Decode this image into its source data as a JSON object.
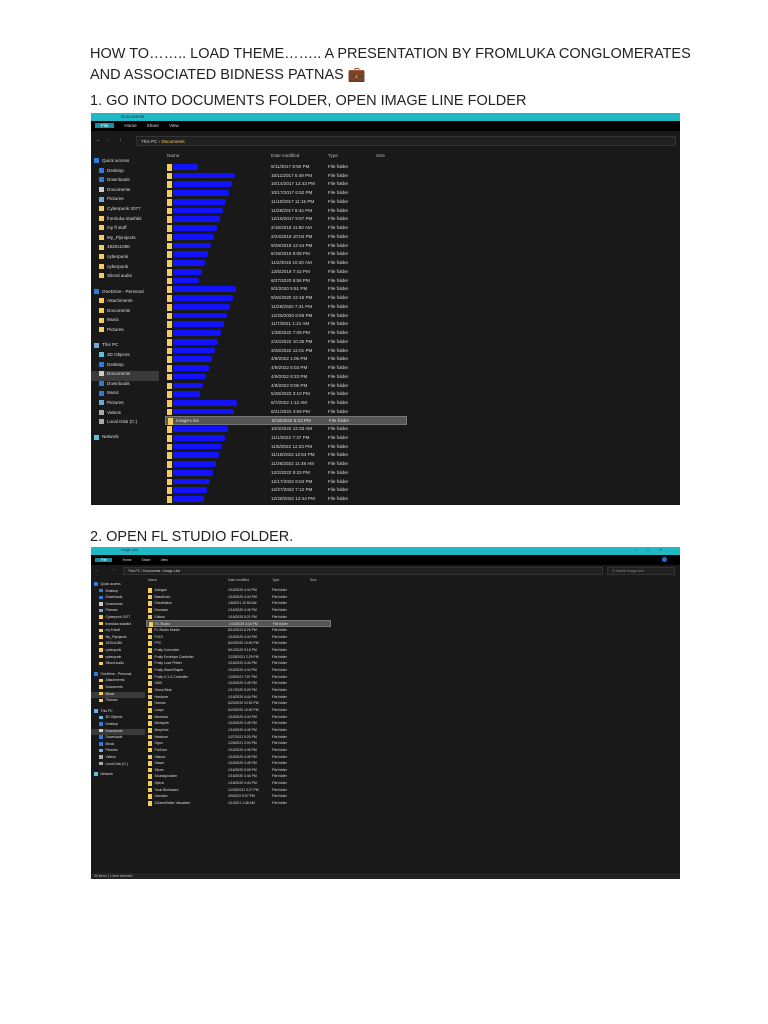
{
  "doc": {
    "heading_line1": "HOW TO…….. LOAD THEME…….. A PRESENTATION BY FROMLUKA CONGLOMERATES",
    "heading_line2": "AND ASSOCIATED BIDNESS PATNAS 💼",
    "step1": "1. GO INTO DOCUMENTS FOLDER, OPEN IMAGE LINE FOLDER",
    "step2": "2. OPEN FL STUDIO FOLDER."
  },
  "shot1": {
    "title": "Documents",
    "ribbon": [
      "File",
      "Home",
      "Share",
      "View"
    ],
    "breadcrumb": [
      "This PC",
      "Documents"
    ],
    "columns": [
      "Name",
      "Date modified",
      "Type",
      "Size"
    ],
    "sidebar": [
      {
        "label": "Quick access",
        "icon": "star-icon"
      },
      {
        "label": "Desktop",
        "icon": "desktop-icon"
      },
      {
        "label": "Downloads",
        "icon": "download-icon"
      },
      {
        "label": "Documents",
        "icon": "document-icon"
      },
      {
        "label": "Pictures",
        "icon": "pictures-icon"
      },
      {
        "label": "Cyberpunk 2077",
        "icon": "folder-icon"
      },
      {
        "label": "fromluka stashkit",
        "icon": "folder-icon"
      },
      {
        "label": "my fl stuff",
        "icon": "folder-icon"
      },
      {
        "label": "My_Flprojects",
        "icon": "folder-icon"
      },
      {
        "label": "1920x1080",
        "icon": "folder-icon"
      },
      {
        "label": "cyberpunk",
        "icon": "folder-icon"
      },
      {
        "label": "cyberpunk",
        "icon": "folder-icon"
      },
      {
        "label": "Sliced audio",
        "icon": "folder-icon"
      },
      {
        "label": "OneDrive - Personal",
        "icon": "cloud-icon"
      },
      {
        "label": "Attachments",
        "icon": "folder-icon"
      },
      {
        "label": "Documents",
        "icon": "folder-icon"
      },
      {
        "label": "Music",
        "icon": "folder-icon"
      },
      {
        "label": "Pictures",
        "icon": "folder-icon"
      },
      {
        "label": "This PC",
        "icon": "computer-icon"
      },
      {
        "label": "3D Objects",
        "icon": "cube-icon"
      },
      {
        "label": "Desktop",
        "icon": "desktop-icon"
      },
      {
        "label": "Documents",
        "icon": "document-icon",
        "selected": true
      },
      {
        "label": "Downloads",
        "icon": "download-icon"
      },
      {
        "label": "Music",
        "icon": "music-icon"
      },
      {
        "label": "Pictures",
        "icon": "pictures-icon"
      },
      {
        "label": "Videos",
        "icon": "video-icon"
      },
      {
        "label": "Local Disk (C:)",
        "icon": "disk-icon"
      },
      {
        "label": "Network",
        "icon": "network-icon"
      }
    ],
    "rows": [
      {
        "name": "",
        "date": "9/11/2017 8:50 PM",
        "type": "File folder"
      },
      {
        "name": "",
        "date": "10/11/2017 5:49 PM",
        "type": "File folder"
      },
      {
        "name": "",
        "date": "10/14/2017 12:43 PM",
        "type": "File folder"
      },
      {
        "name": "",
        "date": "10/17/2017 6:52 PM",
        "type": "File folder"
      },
      {
        "name": "",
        "date": "11/10/2017 11:15 PM",
        "type": "File folder"
      },
      {
        "name": "",
        "date": "11/28/2017 9:44 PM",
        "type": "File folder"
      },
      {
        "name": "",
        "date": "12/16/2017 9:57 PM",
        "type": "File folder"
      },
      {
        "name": "",
        "date": "2/18/2018 11:50 AM",
        "type": "File folder"
      },
      {
        "name": "",
        "date": "2/24/2018 10:04 PM",
        "type": "File folder"
      },
      {
        "name": "",
        "date": "9/29/2018 12:44 PM",
        "type": "File folder"
      },
      {
        "name": "",
        "date": "8/19/2019 8:08 PM",
        "type": "File folder"
      },
      {
        "name": "",
        "date": "11/2/2019 10:20 AM",
        "type": "File folder"
      },
      {
        "name": "",
        "date": "12/5/2019 7:42 PM",
        "type": "File folder"
      },
      {
        "name": "",
        "date": "6/27/2020 6:58 PM",
        "type": "File folder"
      },
      {
        "name": "",
        "date": "9/2/2020 5:51 PM",
        "type": "File folder"
      },
      {
        "name": "",
        "date": "9/26/2020 12:16 PM",
        "type": "File folder"
      },
      {
        "name": "",
        "date": "11/29/2020 7:41 PM",
        "type": "File folder"
      },
      {
        "name": "",
        "date": "12/25/2020 6:59 PM",
        "type": "File folder"
      },
      {
        "name": "",
        "date": "11/7/2021 1:21 AM",
        "type": "File folder"
      },
      {
        "name": "",
        "date": "1/28/2022 7:08 PM",
        "type": "File folder"
      },
      {
        "name": "",
        "date": "2/22/2022 10:35 PM",
        "type": "File folder"
      },
      {
        "name": "",
        "date": "3/26/2022 12:01 PM",
        "type": "File folder"
      },
      {
        "name": "",
        "date": "4/9/2022 1:05 PM",
        "type": "File folder"
      },
      {
        "name": "",
        "date": "4/9/2022 8:03 PM",
        "type": "File folder"
      },
      {
        "name": "",
        "date": "4/9/2022 8:23 PM",
        "type": "File folder"
      },
      {
        "name": "",
        "date": "4/9/2022 9:06 PM",
        "type": "File folder"
      },
      {
        "name": "",
        "date": "5/28/2022 2:10 PM",
        "type": "File folder"
      },
      {
        "name": "",
        "date": "8/7/2022 1:12 AM",
        "type": "File folder"
      },
      {
        "name": "",
        "date": "8/21/2022 4:59 PM",
        "type": "File folder"
      },
      {
        "name": "Image-Line",
        "date": "8/18/2022 6:23 PM",
        "type": "File folder",
        "selected": true
      },
      {
        "name": "",
        "date": "10/3/2022 12:33 AM",
        "type": "File folder"
      },
      {
        "name": "",
        "date": "11/1/2022 7:37 PM",
        "type": "File folder"
      },
      {
        "name": "",
        "date": "11/5/2022 12:23 PM",
        "type": "File folder"
      },
      {
        "name": "",
        "date": "11/18/2022 12:54 PM",
        "type": "File folder"
      },
      {
        "name": "",
        "date": "11/26/2022 11:48 AM",
        "type": "File folder"
      },
      {
        "name": "",
        "date": "12/2/2022 9:33 PM",
        "type": "File folder"
      },
      {
        "name": "",
        "date": "12/17/2022 6:04 PM",
        "type": "File folder"
      },
      {
        "name": "",
        "date": "12/27/2022 7:12 PM",
        "type": "File folder"
      },
      {
        "name": "",
        "date": "12/28/2022 12:44 PM",
        "type": "File folder"
      }
    ]
  },
  "shot2": {
    "title": "Image-Line",
    "ribbon": [
      "File",
      "Home",
      "Share",
      "View"
    ],
    "breadcrumb": [
      "This PC",
      "Documents",
      "Image-Line"
    ],
    "search_placeholder": "Search Image-Line",
    "columns": [
      "Name",
      "Date modified",
      "Type",
      "Size"
    ],
    "status": "33 items  |  1 item selected",
    "sidebar": [
      {
        "label": "Quick access",
        "icon": "star-icon"
      },
      {
        "label": "Desktop",
        "icon": "desktop-icon"
      },
      {
        "label": "Downloads",
        "icon": "download-icon"
      },
      {
        "label": "Documents",
        "icon": "document-icon"
      },
      {
        "label": "Pictures",
        "icon": "pictures-icon"
      },
      {
        "label": "Cyberpunk 2077",
        "icon": "folder-icon"
      },
      {
        "label": "fromluka stashkit",
        "icon": "folder-icon"
      },
      {
        "label": "my fl stuff",
        "icon": "folder-icon"
      },
      {
        "label": "My_Flprojects",
        "icon": "folder-icon"
      },
      {
        "label": "1920x1080",
        "icon": "folder-icon"
      },
      {
        "label": "cyberpunk",
        "icon": "folder-icon"
      },
      {
        "label": "cyberpunk",
        "icon": "folder-icon"
      },
      {
        "label": "Sliced audio",
        "icon": "folder-icon"
      },
      {
        "label": "OneDrive - Personal",
        "icon": "cloud-icon"
      },
      {
        "label": "Attachments",
        "icon": "folder-icon"
      },
      {
        "label": "Documents",
        "icon": "folder-icon"
      },
      {
        "label": "Music",
        "icon": "folder-icon",
        "selected": true
      },
      {
        "label": "Pictures",
        "icon": "folder-icon"
      },
      {
        "label": "This PC",
        "icon": "computer-icon"
      },
      {
        "label": "3D Objects",
        "icon": "cube-icon"
      },
      {
        "label": "Desktop",
        "icon": "desktop-icon"
      },
      {
        "label": "Documents",
        "icon": "document-icon",
        "selected": true
      },
      {
        "label": "Downloads",
        "icon": "download-icon"
      },
      {
        "label": "Music",
        "icon": "music-icon"
      },
      {
        "label": "Pictures",
        "icon": "pictures-icon"
      },
      {
        "label": "Videos",
        "icon": "video-icon"
      },
      {
        "label": "Local Disk (C:)",
        "icon": "disk-icon"
      },
      {
        "label": "Network",
        "icon": "network-icon"
      }
    ],
    "rows": [
      {
        "name": "Autogun",
        "date": "1/16/2020 4:44 PM",
        "type": "File folder"
      },
      {
        "name": "BassDrum",
        "date": "1/16/2020 4:44 PM",
        "type": "File folder"
      },
      {
        "name": "DirectWave",
        "date": "1/8/2021 12:50 AM",
        "type": "File folder"
      },
      {
        "name": "Drumaxx",
        "date": "1/16/2020 4:45 PM",
        "type": "File folder"
      },
      {
        "name": "Edison",
        "date": "1/16/2020 5:21 PM",
        "type": "File folder"
      },
      {
        "name": "FL Studio",
        "date": "1/16/2020 4:44 PM",
        "type": "File folder",
        "selected": true
      },
      {
        "name": "FL Studio Mobile",
        "date": "8/10/2022 6:26 PM",
        "type": "File folder"
      },
      {
        "name": "FLEX",
        "date": "1/16/2020 4:44 PM",
        "type": "File folder"
      },
      {
        "name": "FPC",
        "date": "6/20/2020 10:50 PM",
        "type": "File folder"
      },
      {
        "name": "Fruity Convolver",
        "date": "6/12/2020 9:15 PM",
        "type": "File folder"
      },
      {
        "name": "Fruity Envelope Controller",
        "date": "12/25/2021 2:29 PM",
        "type": "File folder"
      },
      {
        "name": "Fruity Love Philter",
        "date": "1/16/2020 4:44 PM",
        "type": "File folder"
      },
      {
        "name": "Fruity WaveShaper",
        "date": "1/16/2020 4:44 PM",
        "type": "File folder"
      },
      {
        "name": "Fruity X-Y-Z Controller",
        "date": "1/26/2021 7:57 PM",
        "type": "File folder"
      },
      {
        "name": "GMS",
        "date": "1/16/2020 4:45 PM",
        "type": "File folder"
      },
      {
        "name": "Gross Beat",
        "date": "1/17/2020 5:25 PM",
        "type": "File folder"
      },
      {
        "name": "Hardcore",
        "date": "1/16/2020 4:44 PM",
        "type": "File folder"
      },
      {
        "name": "Harmor",
        "date": "6/20/2020 10:50 PM",
        "type": "File folder"
      },
      {
        "name": "Loops",
        "date": "6/20/2020 10:50 PM",
        "type": "File folder"
      },
      {
        "name": "Maximus",
        "date": "1/16/2020 4:44 PM",
        "type": "File folder"
      },
      {
        "name": "Minisynth",
        "date": "1/16/2020 4:45 PM",
        "type": "File folder"
      },
      {
        "name": "Morphine",
        "date": "1/16/2020 4:45 PM",
        "type": "File folder"
      },
      {
        "name": "Newtone",
        "date": "1/27/2021 5:25 PM",
        "type": "File folder"
      },
      {
        "name": "Ogun",
        "date": "1/25/2021 3:04 PM",
        "type": "File folder"
      },
      {
        "name": "PoiZone",
        "date": "1/16/2020 4:45 PM",
        "type": "File folder"
      },
      {
        "name": "Sakura",
        "date": "1/16/2020 4:45 PM",
        "type": "File folder"
      },
      {
        "name": "Sawer",
        "date": "1/16/2020 4:45 PM",
        "type": "File folder"
      },
      {
        "name": "Slicex",
        "date": "1/16/2020 5:08 PM",
        "type": "File folder"
      },
      {
        "name": "Soundgoodizer",
        "date": "1/16/2020 4:44 PM",
        "type": "File folder"
      },
      {
        "name": "Sytrus",
        "date": "1/16/2020 4:44 PM",
        "type": "File folder"
      },
      {
        "name": "Toxic Biohazard",
        "date": "12/25/2021 3:27 PM",
        "type": "File folder"
      },
      {
        "name": "Vocodex",
        "date": "4/9/2022 9:07 PM",
        "type": "File folder"
      },
      {
        "name": "ZGameEditor Visualizer",
        "date": "1/1/2021 1:46 AM",
        "type": "File folder"
      }
    ]
  }
}
